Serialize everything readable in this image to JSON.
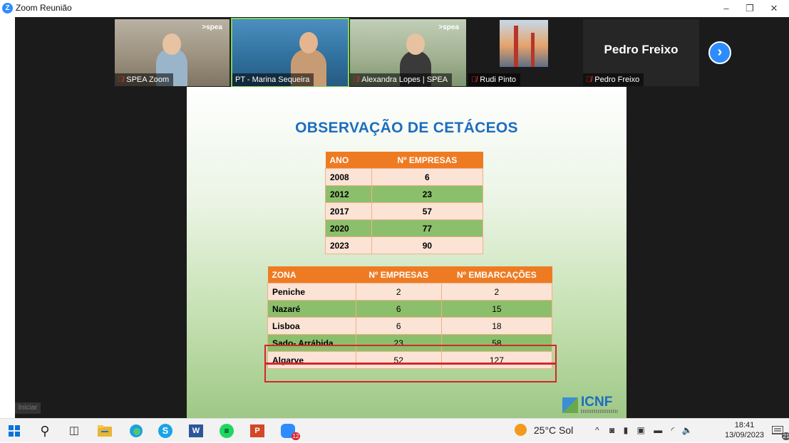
{
  "window": {
    "title": "Zoom Reunião",
    "logo_letter": "Z",
    "minimize_icon": "–",
    "maximize_icon": "❐",
    "close_icon": "✕"
  },
  "gallery": {
    "participants": [
      {
        "name": "SPEA Zoom",
        "muted": true,
        "logo": "spea"
      },
      {
        "name": "PT - Marina Sequeira",
        "muted": false
      },
      {
        "name": "Alexandra Lopes | SPEA",
        "muted": true,
        "logo": "spea"
      },
      {
        "name": "Rudi Pinto",
        "muted": true
      },
      {
        "name": "Pedro Freixo",
        "muted": true,
        "display_name": "Pedro Freixo"
      }
    ],
    "next_icon": "›"
  },
  "slide": {
    "title": "OBSERVAÇÃO DE CETÁCEOS",
    "table1": {
      "headers": [
        "ANO",
        "Nº EMPRESAS"
      ],
      "rows": [
        [
          "2008",
          "6"
        ],
        [
          "2012",
          "23"
        ],
        [
          "2017",
          "57"
        ],
        [
          "2020",
          "77"
        ],
        [
          "2023",
          "90"
        ]
      ]
    },
    "table2": {
      "headers": [
        "ZONA",
        "Nº EMPRESAS",
        "Nº EMBARCAÇÕES"
      ],
      "rows": [
        [
          "Peniche",
          "2",
          "2"
        ],
        [
          "Nazaré",
          "6",
          "15"
        ],
        [
          "Lisboa",
          "6",
          "18"
        ],
        [
          "Sado- Arrábida",
          "23",
          "58"
        ],
        [
          "Algarve",
          "52",
          "127"
        ]
      ]
    },
    "logo_text": "ICNF"
  },
  "start_tooltip": "Iniciar",
  "taskbar": {
    "weather": "25°C Sol",
    "time": "18:41",
    "date": "13/09/2023",
    "zoom_badge": "12",
    "notification_count": "21"
  }
}
